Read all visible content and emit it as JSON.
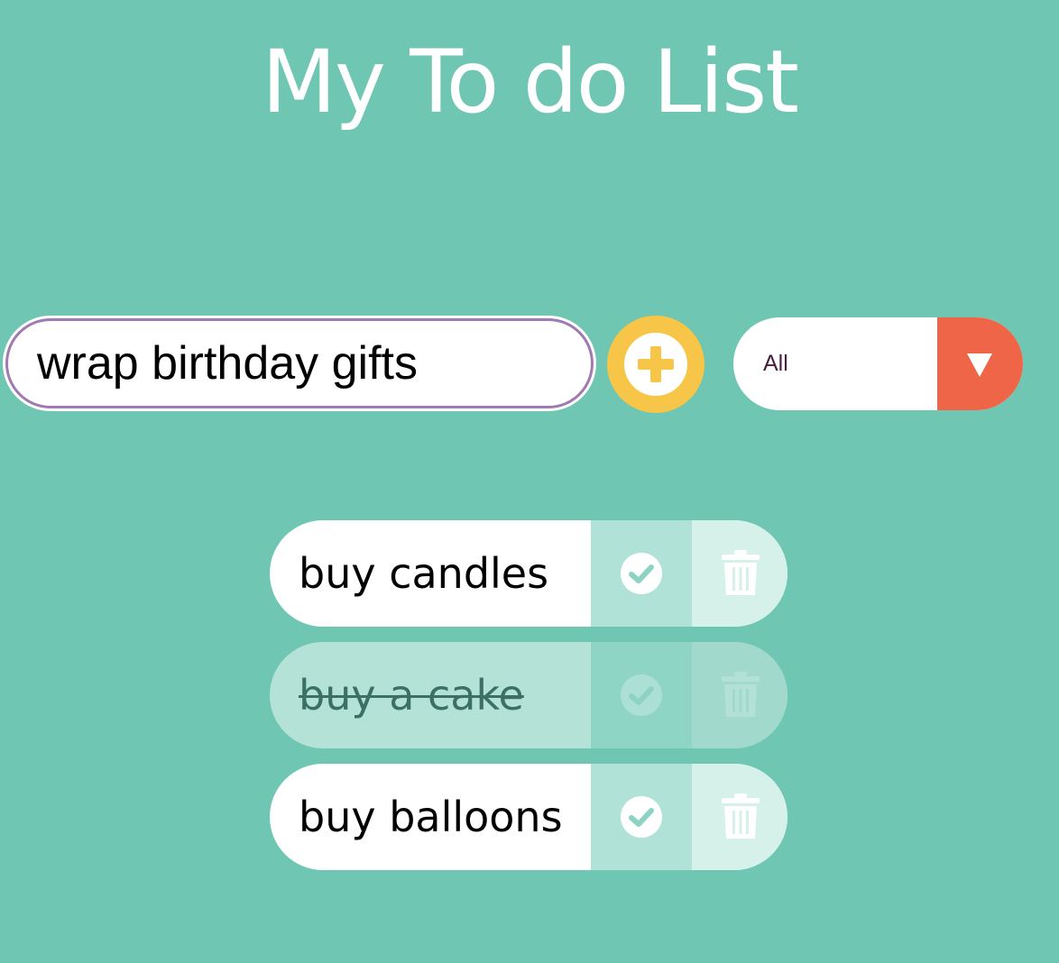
{
  "header": {
    "title": "My To do List"
  },
  "form": {
    "input_value": "wrap birthday gifts",
    "add_icon": "plus-circle-icon",
    "filter": {
      "selected": "All",
      "arrow_icon": "triangle-down-icon"
    }
  },
  "todos": [
    {
      "text": "buy candles",
      "completed": false
    },
    {
      "text": "buy a cake",
      "completed": true
    },
    {
      "text": "buy balloons",
      "completed": false
    }
  ],
  "icons": {
    "complete": "check-circle-icon",
    "delete": "trash-icon"
  },
  "colors": {
    "background": "#6ec6b3",
    "add_button": "#f7c548",
    "filter_arrow": "#ef6548",
    "input_border": "#a07ab2",
    "completed_item": "#b5e2d7"
  }
}
